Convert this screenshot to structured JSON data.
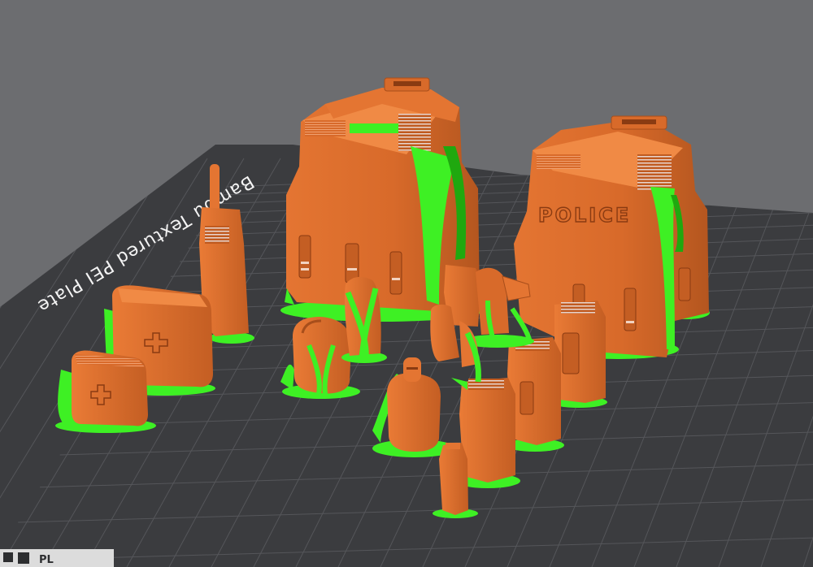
{
  "scene": {
    "plate_label": "Bambu Textured PEI Plate",
    "plate_corner_mark": "PL",
    "vest_texts": [
      "POLICE"
    ],
    "colors": {
      "background": "#6c6d70",
      "plate": "#3b3c3f",
      "grid": "#56575b",
      "model": "#d86a2a",
      "model_shadow": "#a84e1b",
      "model_highlight": "#f08a45",
      "support": "#3ef024",
      "support_dark": "#1fa80f"
    },
    "objects": [
      {
        "name": "police-vest-left"
      },
      {
        "name": "police-vest-right"
      },
      {
        "name": "walkie-talkie"
      },
      {
        "name": "first-aid-kit-large"
      },
      {
        "name": "first-aid-kit-small"
      },
      {
        "name": "handcuffs-pouch"
      },
      {
        "name": "holster"
      },
      {
        "name": "radio-pouch"
      },
      {
        "name": "magazine-pouch-large"
      },
      {
        "name": "magazine-pouch-medium"
      },
      {
        "name": "magazine-pouch-small"
      },
      {
        "name": "utility-pouch"
      },
      {
        "name": "flashlight"
      }
    ]
  }
}
